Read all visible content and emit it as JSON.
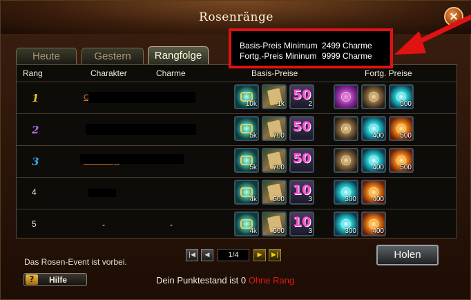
{
  "window": {
    "title": "Rosenränge",
    "close_label": "×"
  },
  "info": {
    "base_label": "Basis-Preis Minimum",
    "base_value": "2499 Charme",
    "adv_label": "Fortg.-Preis Mininum",
    "adv_value": "9999 Charme"
  },
  "tabs": [
    {
      "label": "Heute"
    },
    {
      "label": "Gestern"
    },
    {
      "label": "Rangfolge",
      "active": true
    }
  ],
  "headers": {
    "rank": "Rang",
    "character": "Charakter",
    "charm": "Charme",
    "base": "Basis-Preise",
    "advanced": "Fortg. Preise"
  },
  "rows": [
    {
      "rank": "1",
      "name": "C",
      "base": [
        {
          "icon": "wings-emblem-icon",
          "count": "10k"
        },
        {
          "icon": "scroll-icon",
          "count": "1k"
        },
        {
          "icon": "number-50-icon",
          "count": "2"
        }
      ],
      "advanced": [
        {
          "icon": "pink-crystal-icon",
          "count": ""
        },
        {
          "icon": "golden-orb-icon",
          "count": ""
        },
        {
          "icon": "cyan-orb-icon",
          "count": "500"
        }
      ]
    },
    {
      "rank": "2",
      "name": "",
      "base": [
        {
          "icon": "wings-emblem-icon",
          "count": "5k"
        },
        {
          "icon": "scroll-icon",
          "count": "700"
        },
        {
          "icon": "number-50-icon",
          "count": ""
        }
      ],
      "advanced": [
        {
          "icon": "golden-orb-icon",
          "count": ""
        },
        {
          "icon": "cyan-orb-icon",
          "count": "400"
        },
        {
          "icon": "fire-orb-icon",
          "count": "500"
        }
      ]
    },
    {
      "rank": "3",
      "name": "Shadowqu",
      "base": [
        {
          "icon": "wings-emblem-icon",
          "count": "5k"
        },
        {
          "icon": "scroll-icon",
          "count": "700"
        },
        {
          "icon": "number-50-icon",
          "count": ""
        }
      ],
      "advanced": [
        {
          "icon": "golden-orb-icon",
          "count": ""
        },
        {
          "icon": "cyan-orb-icon",
          "count": "400"
        },
        {
          "icon": "fire-orb-icon",
          "count": "500"
        }
      ]
    },
    {
      "rank": "4",
      "name": "",
      "base": [
        {
          "icon": "wings-emblem-icon",
          "count": "4k"
        },
        {
          "icon": "scroll-icon",
          "count": "500"
        },
        {
          "icon": "number-10-icon",
          "count": "3"
        }
      ],
      "advanced": [
        {
          "icon": "cyan-orb-icon",
          "count": "300"
        },
        {
          "icon": "fire-orb-icon",
          "count": "400"
        }
      ]
    },
    {
      "rank": "5",
      "name": "-",
      "charm": "-",
      "base": [
        {
          "icon": "wings-emblem-icon",
          "count": "4k"
        },
        {
          "icon": "scroll-icon",
          "count": "500"
        },
        {
          "icon": "number-10-icon",
          "count": "3"
        }
      ],
      "advanced": [
        {
          "icon": "cyan-orb-icon",
          "count": "300"
        },
        {
          "icon": "fire-orb-icon",
          "count": "400"
        }
      ]
    }
  ],
  "pager": {
    "value": "1/4",
    "first": "|◀",
    "prev": "◀",
    "next": "▶",
    "last": "▶|"
  },
  "status": "Das Rosen-Event ist vorbei.",
  "help": {
    "icon": "?",
    "label": "Hilfe"
  },
  "collect_label": "Holen",
  "score": {
    "label": "Dein Punktestand ist",
    "value": "0",
    "rank_text": "Ohne Rang"
  },
  "colors": {
    "rank1": "#f4c020",
    "rank2": "#b070f0",
    "rank3": "#30b0f0",
    "annotation": "#e11212"
  }
}
